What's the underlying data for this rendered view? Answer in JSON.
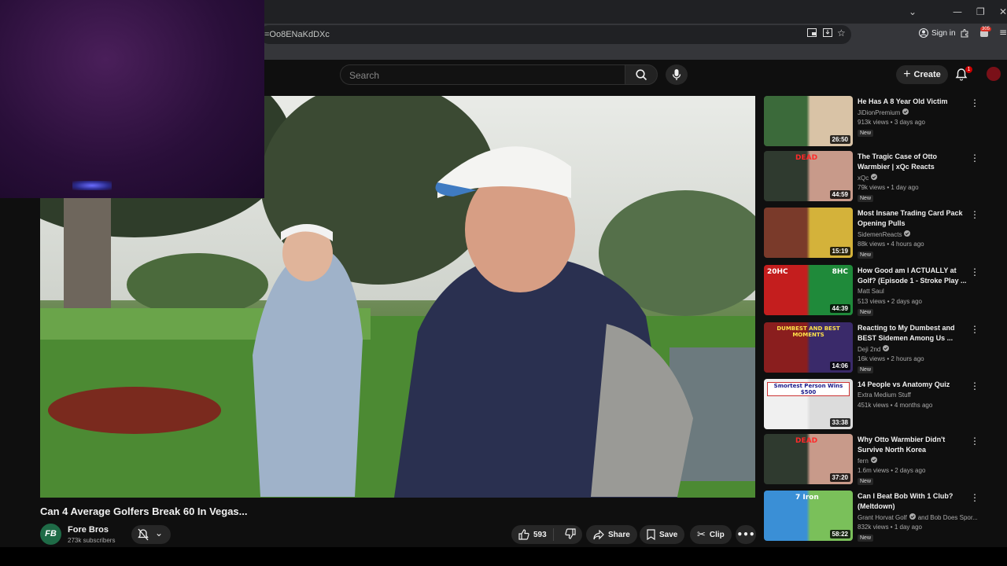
{
  "browser": {
    "url": "=Oo8ENaKdDXc",
    "sign_in": "Sign in",
    "ext_badge": "305",
    "controls": {
      "dropdown": "⌄",
      "minimize": "—",
      "restore": "❐",
      "close": "✕"
    }
  },
  "header": {
    "search_placeholder": "Search",
    "create_label": "Create",
    "notif_count": "1"
  },
  "video": {
    "title": "Can 4 Average Golfers Break 60 In Vegas...",
    "channel_name": "Fore Bros",
    "channel_initials": "FB",
    "subscribers": "273k subscribers",
    "likes": "593",
    "share_label": "Share",
    "save_label": "Save",
    "clip_label": "Clip"
  },
  "recommendations": [
    {
      "title": "He Has A 8 Year Old Victim",
      "channel": "JiDionPremium",
      "verified": true,
      "meta": "913k views • 3 days ago",
      "duration": "26:50",
      "new": "New",
      "thumb_colors": [
        "#3b6a3a",
        "#d9c3a6"
      ]
    },
    {
      "title": "The Tragic Case of Otto Warmbier | xQc Reacts",
      "channel": "xQc",
      "verified": true,
      "meta": "79k views • 1 day ago",
      "duration": "44:59",
      "new": "New",
      "thumb_text": "DEAD",
      "thumb_colors": [
        "#2f3a2f",
        "#c89a8a"
      ]
    },
    {
      "title": "Most Insane Trading Card Pack Opening Pulls",
      "channel": "SidemenReacts",
      "verified": true,
      "meta": "88k views • 4 hours ago",
      "duration": "15:19",
      "new": "New",
      "thumb_colors": [
        "#7a3a2a",
        "#d4b23a"
      ]
    },
    {
      "title": "How Good am I ACTUALLY at Golf? (Episode 1 - Stroke Play ...",
      "channel": "Matt Saul",
      "verified": false,
      "meta": "513 views • 2 days ago",
      "duration": "44:39",
      "new": "New",
      "thumb_text": "20HC",
      "thumb_text2": "8HC",
      "thumb_colors": [
        "#c41e1e",
        "#1f8a3a"
      ]
    },
    {
      "title": "Reacting to My Dumbest and BEST Sidemen Among Us ...",
      "channel": "Deji 2nd",
      "verified": true,
      "meta": "16k views • 2 hours ago",
      "duration": "14:06",
      "new": "New",
      "thumb_text": "DUMBEST AND BEST MOMENTS",
      "thumb_colors": [
        "#8a1e1e",
        "#3a2a6a"
      ]
    },
    {
      "title": "14 People vs Anatomy Quiz",
      "channel": "Extra Medium Stuff",
      "verified": false,
      "meta": "451k views • 4 months ago",
      "duration": "33:38",
      "new": "",
      "thumb_text": "Smortest Person Wins $500",
      "thumb_colors": [
        "#f0f0f0",
        "#dcdcdc"
      ]
    },
    {
      "title": "Why Otto Warmbier Didn't Survive North Korea",
      "channel": "fern",
      "verified": true,
      "meta": "1.6m views • 2 days ago",
      "duration": "37:20",
      "new": "New",
      "thumb_text": "DEAD",
      "thumb_colors": [
        "#2f3a2f",
        "#c89a8a"
      ]
    },
    {
      "title": "Can I Beat Bob With 1 Club? (Meltdown)",
      "channel": "Grant Horvat Golf",
      "channel_extra": "and Bob Does Spor...",
      "verified": true,
      "meta": "832k views • 1 day ago",
      "duration": "58:22",
      "new": "New",
      "thumb_text": "7 Iron",
      "thumb_colors": [
        "#3a8fd6",
        "#7ac05a"
      ]
    }
  ]
}
